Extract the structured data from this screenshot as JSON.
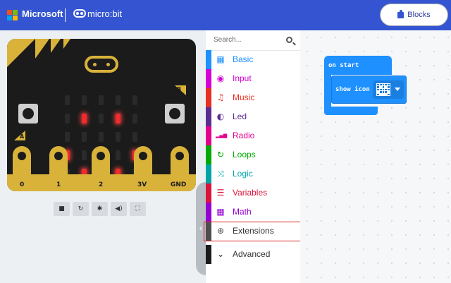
{
  "header": {
    "brand": "Microsoft",
    "product": "micro:bit",
    "blocks_label": "Blocks"
  },
  "simulator": {
    "pins": [
      "0",
      "1",
      "2",
      "3V",
      "GND"
    ],
    "button_a": "A",
    "button_b": "B",
    "led_matrix": [
      [
        0,
        0,
        0,
        0,
        0
      ],
      [
        0,
        1,
        0,
        1,
        0
      ],
      [
        0,
        0,
        0,
        0,
        0
      ],
      [
        1,
        0,
        0,
        0,
        1
      ],
      [
        0,
        1,
        1,
        1,
        0
      ]
    ],
    "controls": [
      "stop-icon",
      "restart-icon",
      "debug-icon",
      "mute-icon",
      "fullscreen-icon"
    ]
  },
  "toolbox": {
    "search_placeholder": "Search...",
    "categories": [
      {
        "label": "Basic",
        "color": "#1e90ff",
        "icon": "grid-icon"
      },
      {
        "label": "Input",
        "color": "#d400d4",
        "icon": "target-icon"
      },
      {
        "label": "Music",
        "color": "#e63022",
        "icon": "headphones-icon"
      },
      {
        "label": "Led",
        "color": "#5c2d91",
        "icon": "toggle-icon"
      },
      {
        "label": "Radio",
        "color": "#e3008c",
        "icon": "signal-icon"
      },
      {
        "label": "Loops",
        "color": "#00aa00",
        "icon": "refresh-icon"
      },
      {
        "label": "Logic",
        "color": "#00a4a6",
        "icon": "shuffle-icon"
      },
      {
        "label": "Variables",
        "color": "#dc143c",
        "icon": "list-icon"
      },
      {
        "label": "Math",
        "color": "#9400d3",
        "icon": "calculator-icon"
      },
      {
        "label": "Extensions",
        "color": "#4d4d4d",
        "icon": "plus-circle-icon"
      },
      {
        "label": "Advanced",
        "color": "#1b1b1b",
        "icon": "chevron-down-icon"
      }
    ]
  },
  "workspace": {
    "on_start_label": "on start",
    "show_icon_label": "show icon"
  }
}
